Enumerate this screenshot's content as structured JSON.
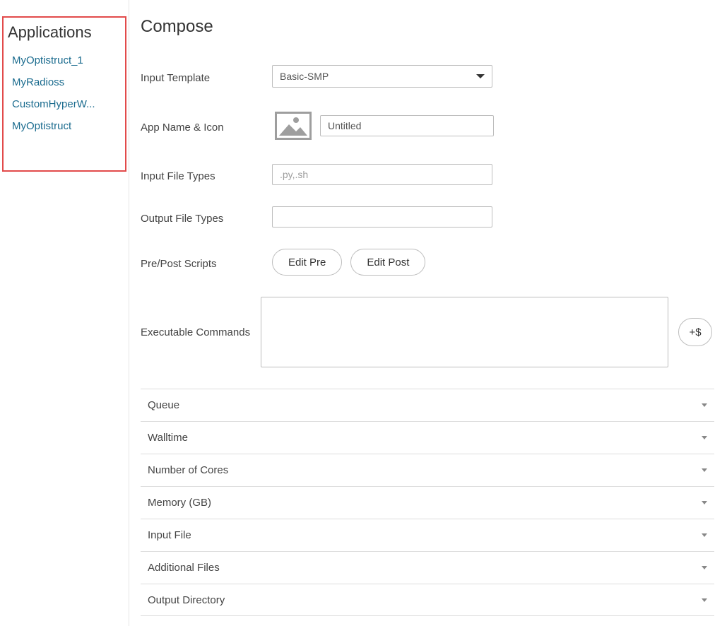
{
  "sidebar": {
    "title": "Applications",
    "items": [
      "MyOptistruct_1",
      "MyRadioss",
      "CustomHyperW...",
      "MyOptistruct"
    ]
  },
  "page": {
    "title": "Compose"
  },
  "form": {
    "input_template": {
      "label": "Input Template",
      "value": "Basic-SMP"
    },
    "app_name": {
      "label": "App Name & Icon",
      "value": "Untitled"
    },
    "input_file_types": {
      "label": "Input File Types",
      "value": "",
      "placeholder": ".py,.sh"
    },
    "output_file_types": {
      "label": "Output File Types",
      "value": ""
    },
    "scripts": {
      "label": "Pre/Post Scripts",
      "edit_pre": "Edit Pre",
      "edit_post": "Edit Post"
    },
    "exec": {
      "label": "Executable Commands",
      "value": "",
      "var_btn": "+$"
    }
  },
  "accordion": [
    "Queue",
    "Walltime",
    "Number of Cores",
    "Memory (GB)",
    "Input File",
    "Additional Files",
    "Output Directory"
  ]
}
